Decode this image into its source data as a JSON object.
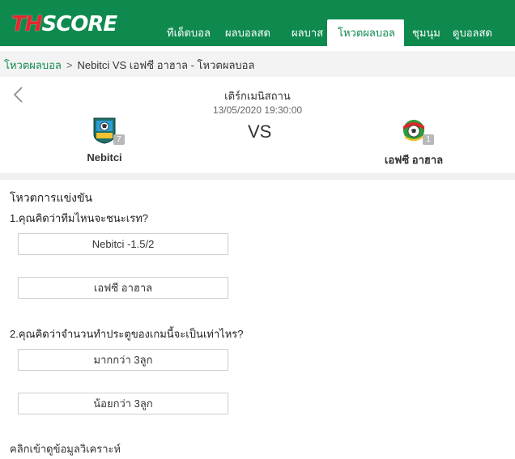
{
  "header": {
    "logo_th": "TH",
    "logo_score": "SCORE",
    "nav": [
      {
        "label": "ทีเด็ดบอล",
        "active": false
      },
      {
        "label": "ผลบอลสด",
        "active": false
      },
      {
        "label": "ผลบาส",
        "active": false
      },
      {
        "label": "โหวตผลบอล",
        "active": true
      },
      {
        "label": "ชุมนุม",
        "active": false
      },
      {
        "label": "ดูบอลสด",
        "active": false
      }
    ]
  },
  "breadcrumb": {
    "home": "โหวตผลบอล",
    "separator": ">",
    "current": "Nebitci VS เอฟซี อาฮาล - โหวตผลบอล"
  },
  "match": {
    "league": "เติร์กเมนิสถาน",
    "datetime": "13/05/2020 19:30:00",
    "vs_label": "VS",
    "home": {
      "name": "Nebitci",
      "rank": "7"
    },
    "away": {
      "name": "เอฟซี อาฮาล",
      "rank": "1"
    }
  },
  "prediction": {
    "title": "โหวตการแข่งขัน",
    "questions": [
      {
        "text": "1.คุณคิดว่าทีมไหนจะชนะเรท?",
        "options": [
          "Nebitci -1.5/2",
          "เอฟซี อาฮาล"
        ]
      },
      {
        "text": "2.คุณคิดว่าจำนวนทำประตูของเกมนี้จะเป็นเท่าไหร?",
        "options": [
          "มากกว่า 3ลูก",
          "น้อยกว่า 3ลูก"
        ]
      }
    ],
    "analysis_link": "คลิกเข้าดูข้อมูลวิเคราะห์"
  },
  "colors": {
    "brand_green": "#0f8a4f",
    "logo_red": "#e8262d",
    "rank_badge": "#b8b8b8"
  },
  "icons": {
    "back": "chevron-left-icon",
    "home_crest": "nebitci-crest-icon",
    "away_crest": "ahal-crest-icon"
  }
}
